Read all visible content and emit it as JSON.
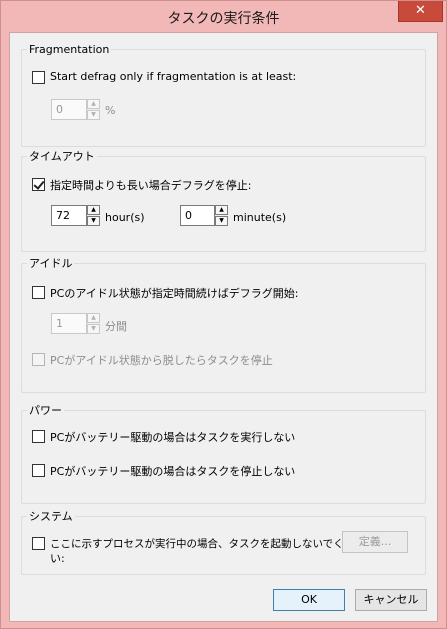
{
  "window": {
    "title": "タスクの実行条件",
    "close_glyph": "✕"
  },
  "fragmentation": {
    "legend": "Fragmentation",
    "checkbox_label": "Start defrag only if fragmentation is at least:",
    "value": "0",
    "unit": "%",
    "checked": false
  },
  "timeout": {
    "legend": "タイムアウト",
    "checkbox_label": "指定時間よりも長い場合デフラグを停止:",
    "checked": true,
    "hours_value": "72",
    "hours_unit": "hour(s)",
    "minutes_value": "0",
    "minutes_unit": "minute(s)"
  },
  "idle": {
    "legend": "アイドル",
    "checkbox_label": "PCのアイドル状態が指定時間続けばデフラグ開始:",
    "value": "1",
    "unit": "分間",
    "stop_label": "PCがアイドル状態から脱したらタスクを停止"
  },
  "power": {
    "legend": "パワー",
    "no_start_label": "PCがバッテリー駆動の場合はタスクを実行しない",
    "no_stop_label": "PCがバッテリー駆動の場合はタスクを停止しない"
  },
  "system": {
    "legend": "システム",
    "checkbox_label_line1": "ここに示すプロセスが実行中の場合、タスクを起動しないでくださ",
    "checkbox_label_line2": "い:",
    "define_button": "定義..."
  },
  "footer": {
    "ok_button": "OK",
    "cancel_button": "キャンセル"
  }
}
